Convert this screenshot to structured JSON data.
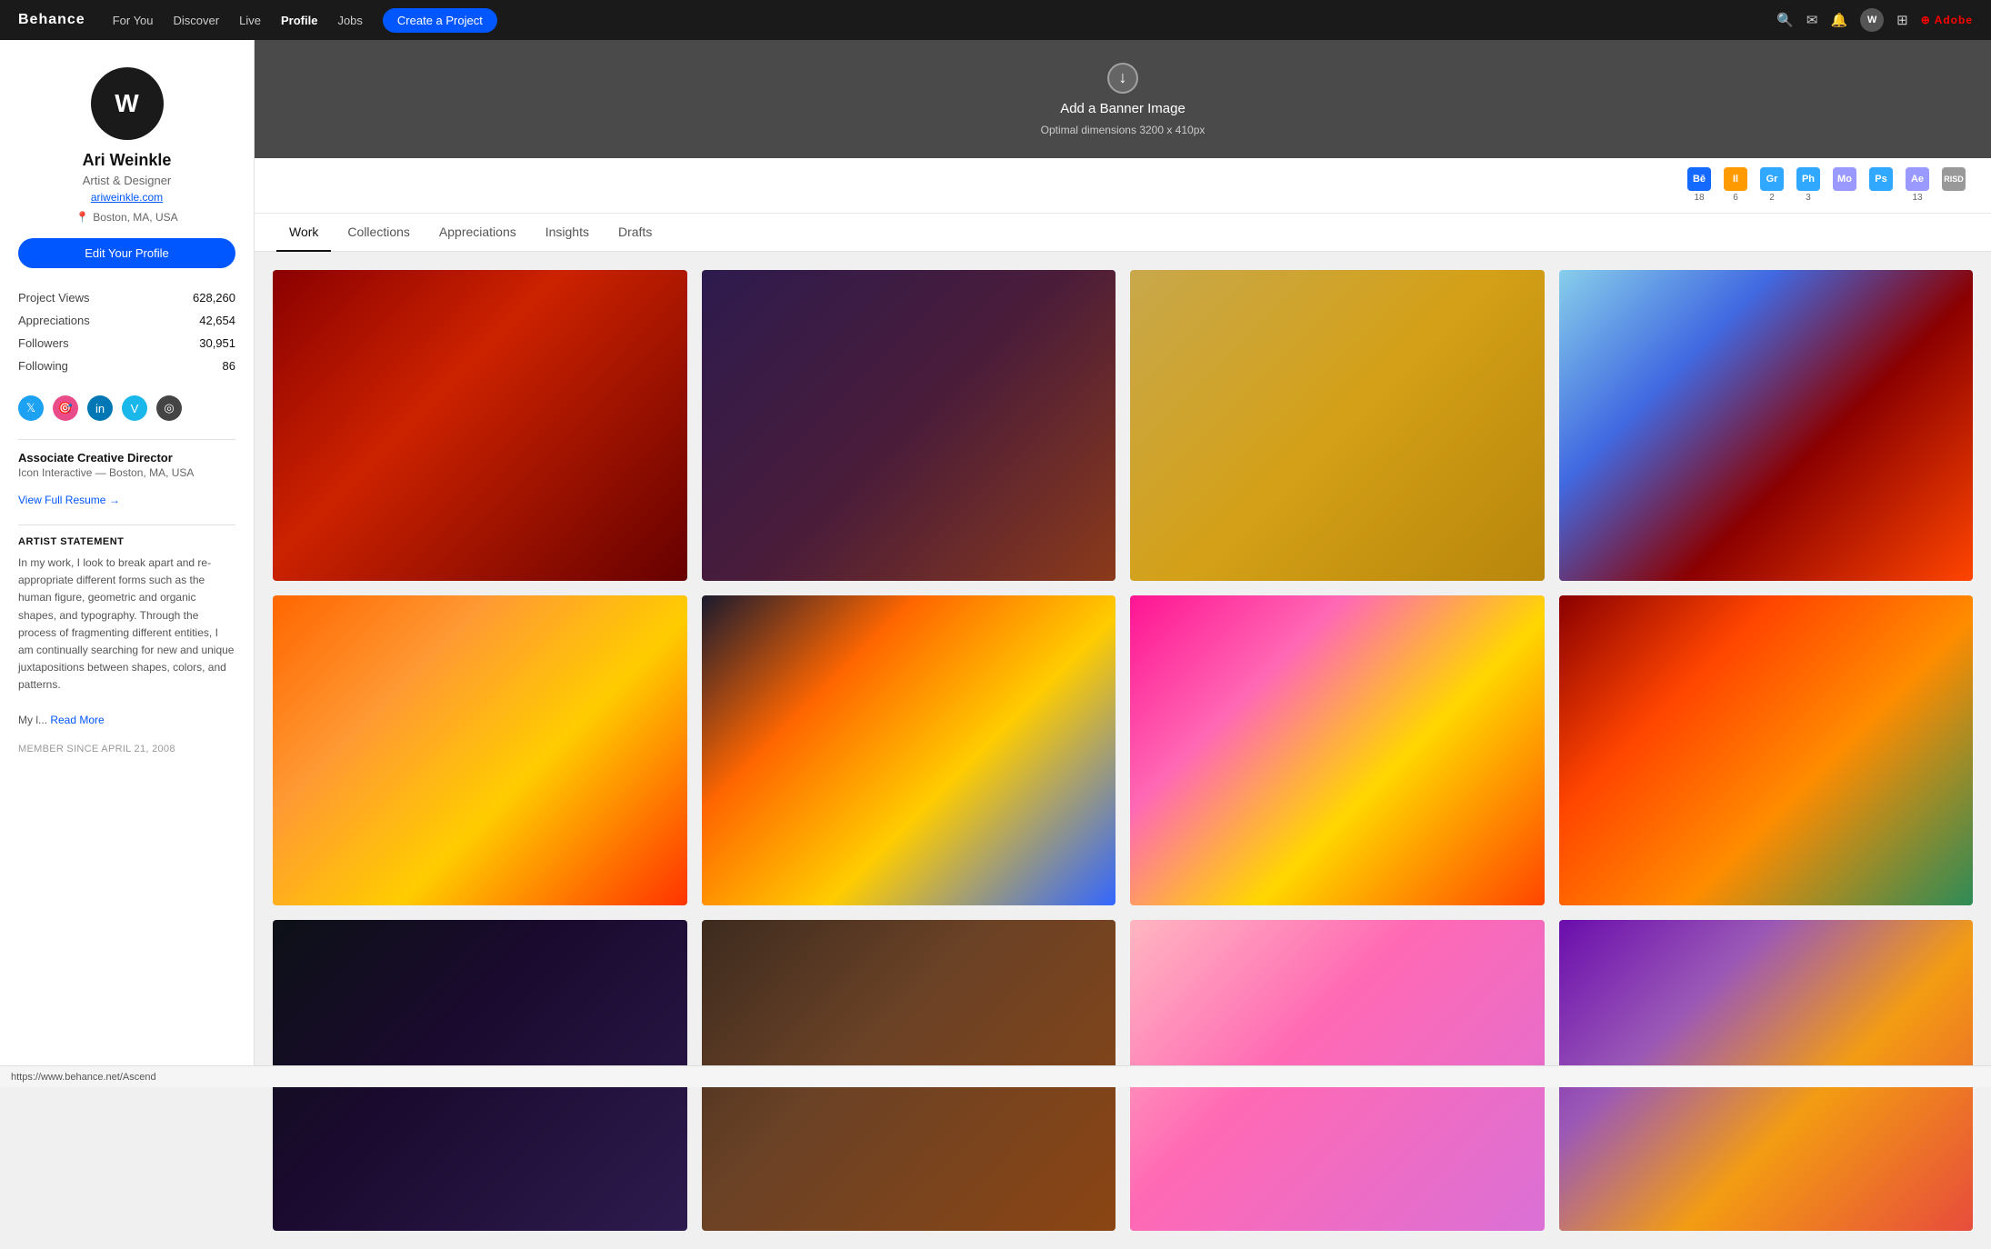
{
  "brand": "Behance",
  "nav": {
    "links": [
      {
        "label": "For You",
        "active": false
      },
      {
        "label": "Discover",
        "active": false
      },
      {
        "label": "Live",
        "active": false
      },
      {
        "label": "Profile",
        "active": true
      },
      {
        "label": "Jobs",
        "active": false
      }
    ],
    "cta_label": "Create a Project",
    "icons": [
      "search",
      "message",
      "bell",
      "grid",
      "adobe"
    ],
    "user_initials": "W"
  },
  "banner": {
    "text": "Add a Banner Image",
    "subtext": "Optimal dimensions 3200 x 410px"
  },
  "profile": {
    "name": "Ari Weinkle",
    "title": "Artist & Designer",
    "website": "ariweinkle.com",
    "location": "Boston, MA, USA",
    "edit_button": "Edit Your Profile",
    "stats": [
      {
        "label": "Project Views",
        "value": "628,260"
      },
      {
        "label": "Appreciations",
        "value": "42,654"
      },
      {
        "label": "Followers",
        "value": "30,951"
      },
      {
        "label": "Following",
        "value": "86"
      }
    ],
    "job_title": "Associate Creative Director",
    "job_company": "Icon Interactive — Boston, MA, USA",
    "view_resume": "View Full Resume →",
    "artist_statement_title": "ARTIST STATEMENT",
    "artist_statement": "In my work, I look to break apart and re-appropriate different forms such as the human figure, geometric and organic shapes, and typography. Through the process of fragmenting different entities, I am continually searching for new and unique juxtapositions between shapes, colors, and patterns.",
    "artist_statement_continuation": "My l...",
    "read_more": "Read More",
    "member_since": "MEMBER SINCE APRIL 21, 2008",
    "initials": "W",
    "social_icons": [
      {
        "name": "twitter-icon",
        "symbol": "𝕋"
      },
      {
        "name": "dribbble-icon",
        "symbol": "⊕"
      },
      {
        "name": "linkedin-icon",
        "symbol": "in"
      },
      {
        "name": "vimeo-icon",
        "symbol": "V"
      },
      {
        "name": "circle-icon",
        "symbol": "○"
      }
    ]
  },
  "app_badges": [
    {
      "abbr": "Bē",
      "count": "18",
      "color_class": "badge-be"
    },
    {
      "abbr": "Il",
      "count": "6",
      "color_class": "badge-il"
    },
    {
      "abbr": "Gr",
      "count": "2",
      "color_class": "badge-gr"
    },
    {
      "abbr": "Ph",
      "count": "3",
      "color_class": "badge-ph"
    },
    {
      "abbr": "Mo",
      "count": "",
      "color_class": "badge-mo"
    },
    {
      "abbr": "Ps",
      "count": "",
      "color_class": "badge-ps"
    },
    {
      "abbr": "Ae",
      "count": "13",
      "color_class": "badge-ae"
    },
    {
      "abbr": "RISD",
      "count": "",
      "color_class": "badge-risd"
    }
  ],
  "tabs": [
    {
      "label": "Work",
      "active": true
    },
    {
      "label": "Collections",
      "active": false
    },
    {
      "label": "Appreciations",
      "active": false
    },
    {
      "label": "Insights",
      "active": false
    },
    {
      "label": "Drafts",
      "active": false
    }
  ],
  "projects": [
    {
      "id": 1,
      "color_class": "img-red-metal"
    },
    {
      "id": 2,
      "color_class": "img-dark-organic"
    },
    {
      "id": 3,
      "color_class": "img-gold-figure"
    },
    {
      "id": 4,
      "color_class": "img-blue-swirl"
    },
    {
      "id": 5,
      "color_class": "img-orange-fan"
    },
    {
      "id": 6,
      "color_class": "img-wave-lines"
    },
    {
      "id": 7,
      "color_class": "img-pink-bloom"
    },
    {
      "id": 8,
      "color_class": "img-red-orange-swirl"
    },
    {
      "id": 9,
      "color_class": "img-dark-gradient1"
    },
    {
      "id": 10,
      "color_class": "img-brown-organic"
    },
    {
      "id": 11,
      "color_class": "img-pink-blur"
    },
    {
      "id": 12,
      "color_class": "img-purple-yellow"
    }
  ],
  "url_bar": {
    "url": "https://www.behance.net/Ascend"
  }
}
